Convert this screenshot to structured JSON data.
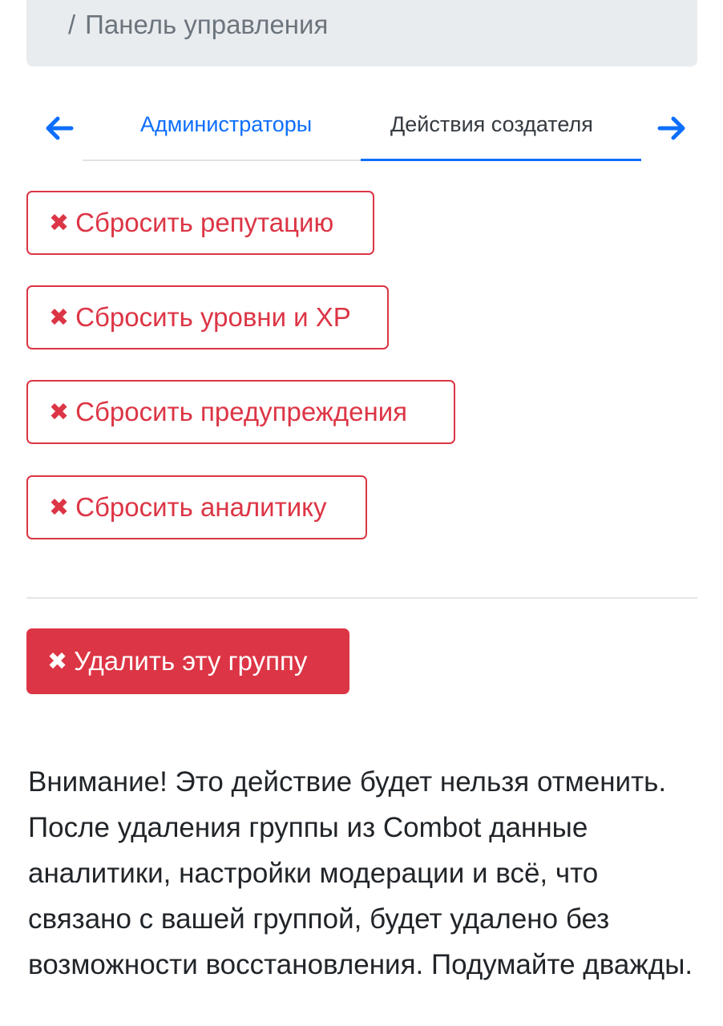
{
  "breadcrumb": {
    "separator": "/",
    "current": "Панель управления"
  },
  "tabs": {
    "left_arrow_icon": "arrow-left-icon",
    "right_arrow_icon": "arrow-right-icon",
    "items": [
      {
        "label": "Администраторы",
        "active": false
      },
      {
        "label": "Действия создателя",
        "active": true
      }
    ]
  },
  "actions": {
    "x_glyph": "✖",
    "reset_reputation": "Сбросить репутацию",
    "reset_levels_xp": "Сбросить уровни и XP",
    "reset_warnings": "Сбросить предупреждения",
    "reset_analytics": "Сбросить аналитику",
    "delete_group": "Удалить эту группу"
  },
  "warning_text": "Внимание! Это действие будет нельзя отменить. После удаления группы из Combot данные аналитики, настройки модерации и всё, что связано с вашей группой, будет удалено без возможности восстановления. Подумайте дважды.",
  "colors": {
    "primary": "#0d6efd",
    "danger": "#dc3545",
    "panel_bg": "#e9ecef",
    "muted_text": "#6c757d"
  }
}
